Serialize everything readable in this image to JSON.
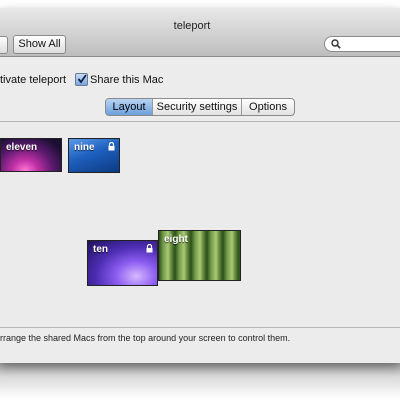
{
  "window": {
    "title": "teleport",
    "show_all_label": "Show All"
  },
  "options": {
    "activate_label": "tivate teleport",
    "share_label": "Share this Mac",
    "share_checked": true
  },
  "tabs": [
    {
      "label": "Layout",
      "active": true
    },
    {
      "label": "Security settings",
      "active": false
    },
    {
      "label": "Options",
      "active": false
    }
  ],
  "machines": [
    {
      "name": "eleven",
      "locked": false
    },
    {
      "name": "nine",
      "locked": true
    },
    {
      "name": "ten",
      "locked": true
    },
    {
      "name": "eight",
      "locked": false
    }
  ],
  "status_text": "rrange the shared Macs from the top around your screen to control them.",
  "icons": {
    "search": "search-icon",
    "checkbox": "checkmark-icon",
    "lock": "lock-icon"
  },
  "colors": {
    "tab_active": "#6c9fdc",
    "checkbox_blue": "#7aa6df"
  }
}
